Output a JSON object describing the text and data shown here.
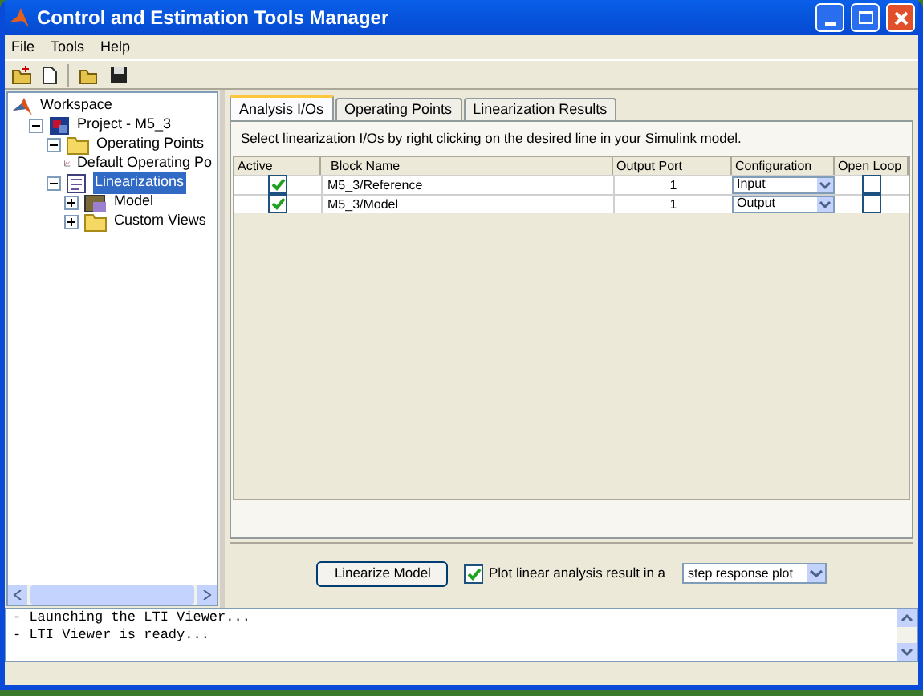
{
  "window": {
    "title": "Control and Estimation Tools Manager"
  },
  "menu": [
    "File",
    "Tools",
    "Help"
  ],
  "tree": [
    {
      "label": "Workspace",
      "kind": "workspace",
      "selected": false,
      "children": [
        {
          "label": "Project - M5_3",
          "kind": "project",
          "expanded": true,
          "selected": false,
          "children": [
            {
              "label": "Operating Points",
              "kind": "folder",
              "expanded": true,
              "selected": false,
              "children": [
                {
                  "label": "Default Operating Po",
                  "kind": "chart",
                  "selected": false
                }
              ]
            },
            {
              "label": "Linearizations",
              "kind": "task",
              "expanded": true,
              "selected": true,
              "children": [
                {
                  "label": "Model",
                  "kind": "model",
                  "expanded": false,
                  "selected": false
                },
                {
                  "label": "Custom Views",
                  "kind": "folder",
                  "expanded": false,
                  "selected": false
                }
              ]
            }
          ]
        }
      ]
    }
  ],
  "tabs": [
    {
      "label": "Analysis I/Os",
      "selected": true
    },
    {
      "label": "Operating Points",
      "selected": false
    },
    {
      "label": "Linearization Results",
      "selected": false
    }
  ],
  "instruction": "Select linearization I/Os by right clicking on the desired line in your Simulink model.",
  "table": {
    "columns": [
      "Active",
      "Block Name",
      "Output Port",
      "Configuration",
      "Open Loop"
    ],
    "rows": [
      {
        "active": true,
        "block": "M5_3/Reference",
        "port": "1",
        "configuration": "Input",
        "open_loop": false
      },
      {
        "active": true,
        "block": "M5_3/Model",
        "port": "1",
        "configuration": "Output",
        "open_loop": false
      }
    ]
  },
  "linearize_button": "Linearize Model",
  "plot_option": {
    "label": "Plot linear analysis result in a",
    "checked": true,
    "value": "step response plot"
  },
  "log": [
    "- Launching the LTI Viewer...",
    "- LTI Viewer is ready..."
  ]
}
